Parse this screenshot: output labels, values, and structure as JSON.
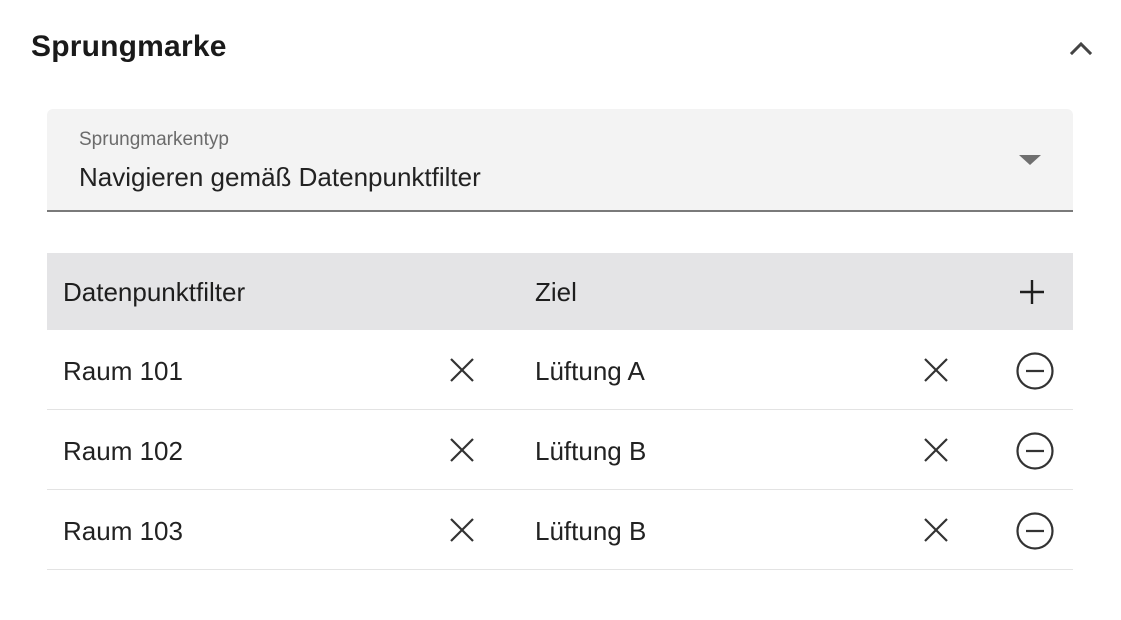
{
  "section": {
    "title": "Sprungmarke",
    "collapse_icon": "chevron-up-icon"
  },
  "select": {
    "label": "Sprungmarkentyp",
    "value": "Navigieren gemäß Datenpunktfilter",
    "arrow_icon": "dropdown-arrow-icon"
  },
  "table": {
    "headers": {
      "filter": "Datenpunktfilter",
      "target": "Ziel"
    },
    "add_icon": "plus-icon",
    "rows": [
      {
        "filter": "Raum 101",
        "target": "Lüftung A"
      },
      {
        "filter": "Raum 102",
        "target": "Lüftung B"
      },
      {
        "filter": "Raum 103",
        "target": "Lüftung B"
      }
    ],
    "clear_icon": "close-icon",
    "remove_icon": "minus-circle-icon"
  },
  "colors": {
    "header_bg": "#e4e4e6",
    "field_bg": "#f3f3f3",
    "text": "#212121",
    "label": "#6b6b6b"
  }
}
